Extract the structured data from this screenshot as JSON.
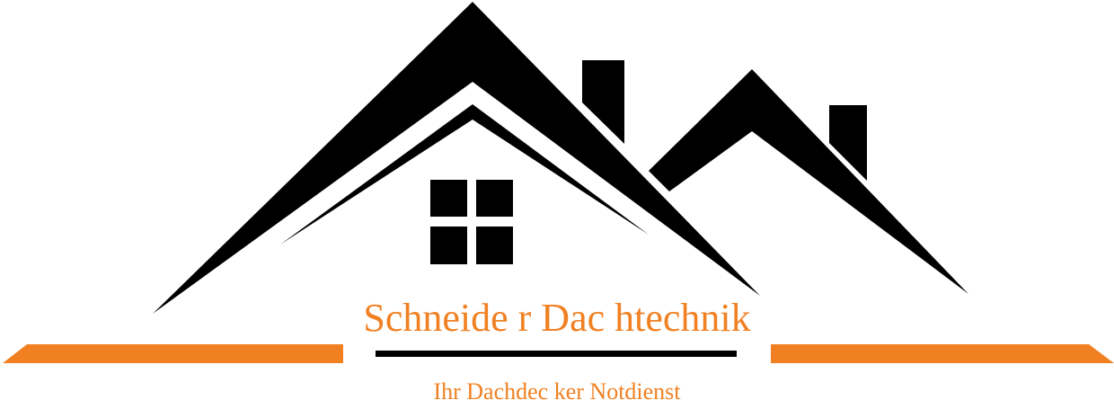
{
  "logo": {
    "company_name": "Schneide r Dac htechnik",
    "tagline": "Ihr Dachdec ker Notdienst",
    "icon": "house-roof-icon",
    "colors": {
      "roof": "#000000",
      "accent": "#f08022",
      "background": "#ffffff"
    }
  }
}
